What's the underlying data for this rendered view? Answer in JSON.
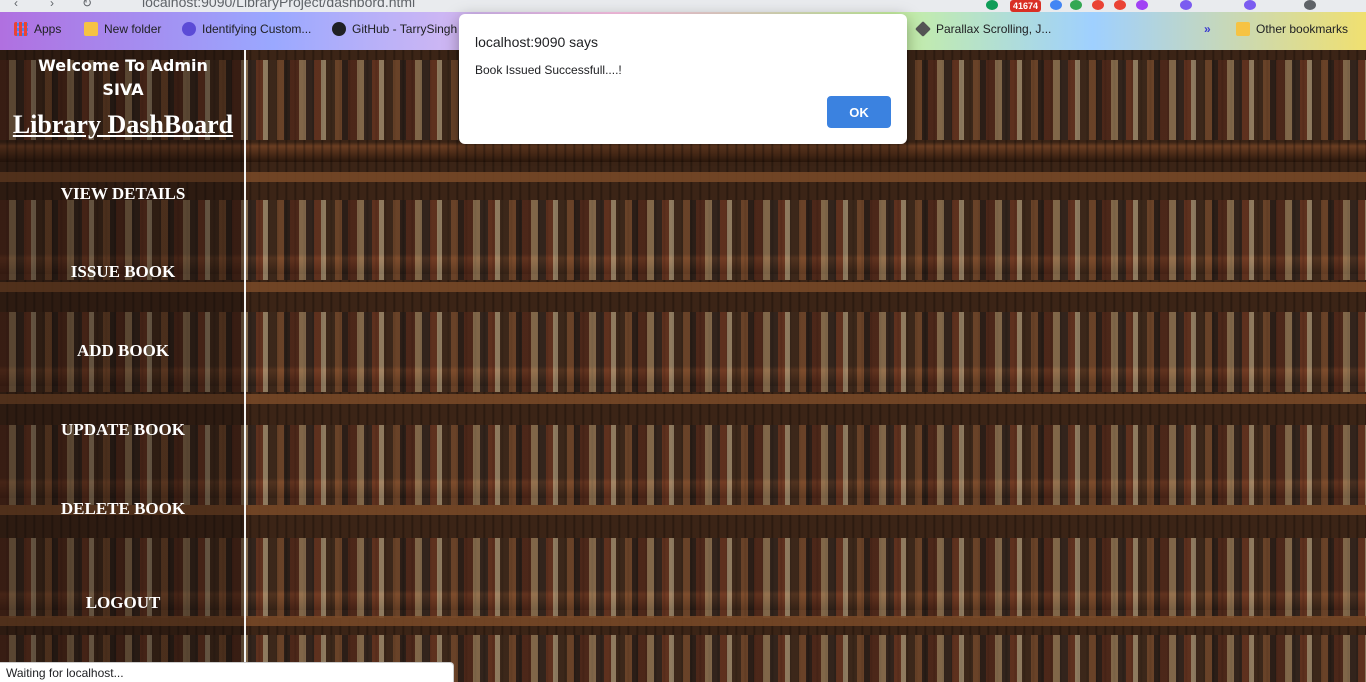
{
  "browser": {
    "url": "localhost:9090/LibraryProject/dashbord.html",
    "bookmarks": [
      {
        "label": "Apps"
      },
      {
        "label": "New folder"
      },
      {
        "label": "Identifying Custom..."
      },
      {
        "label": "GitHub - TarrySingh"
      },
      {
        "label": "Parallax Scrolling, J..."
      }
    ],
    "other_bookmarks": "Other bookmarks",
    "extension_badge": "41674",
    "overflow_chevron": "»"
  },
  "sidebar": {
    "welcome_line1": "Welcome To Admin",
    "welcome_line2": "SIVA",
    "title": "Library DashBoard",
    "items": [
      {
        "label": "VIEW DETAILS"
      },
      {
        "label": "ISSUE BOOK"
      },
      {
        "label": "ADD BOOK"
      },
      {
        "label": "UPDATE BOOK"
      },
      {
        "label": "DELETE BOOK"
      },
      {
        "label": "LOGOUT"
      }
    ]
  },
  "dialog": {
    "title": "localhost:9090 says",
    "message": "Book Issued Successfull....!",
    "ok_label": "OK"
  },
  "status_bar": {
    "text": "Waiting for localhost..."
  },
  "colors": {
    "dialog_button": "#3b82e0",
    "sidebar_text": "#ffffff"
  }
}
